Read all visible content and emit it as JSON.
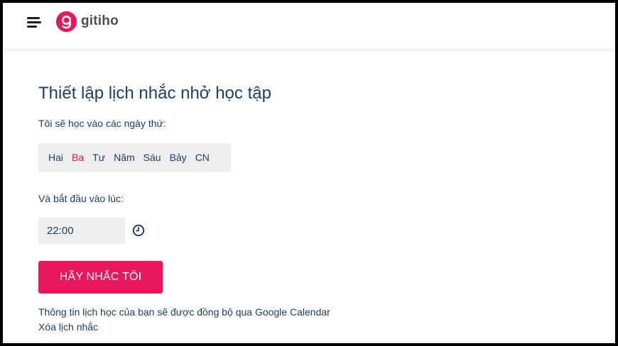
{
  "header": {
    "logo_text": "gitiho",
    "brand_color": "#e8175d"
  },
  "page": {
    "title": "Thiết lập lịch nhắc nhở học tập",
    "days_label": "Tôi sẽ học vào các ngày thứ:",
    "days": [
      {
        "label": "Hai",
        "selected": false
      },
      {
        "label": "Ba",
        "selected": true
      },
      {
        "label": "Tư",
        "selected": false
      },
      {
        "label": "Năm",
        "selected": false
      },
      {
        "label": "Sáu",
        "selected": false
      },
      {
        "label": "Bảy",
        "selected": false
      },
      {
        "label": "CN",
        "selected": false
      }
    ],
    "start_label": "Và bắt đầu vào lúc:",
    "time_value": "22:00",
    "remind_button": "HÃY NHẮC TÔI",
    "sync_note": "Thông tin lịch học của bạn sẽ được đồng bộ qua Google Calendar",
    "clear_link": "Xóa lịch nhắc"
  },
  "colors": {
    "text": "#1f3f62",
    "accent": "#e8175d",
    "day_selected": "#e8175d",
    "input_bg": "#eeeeee"
  }
}
